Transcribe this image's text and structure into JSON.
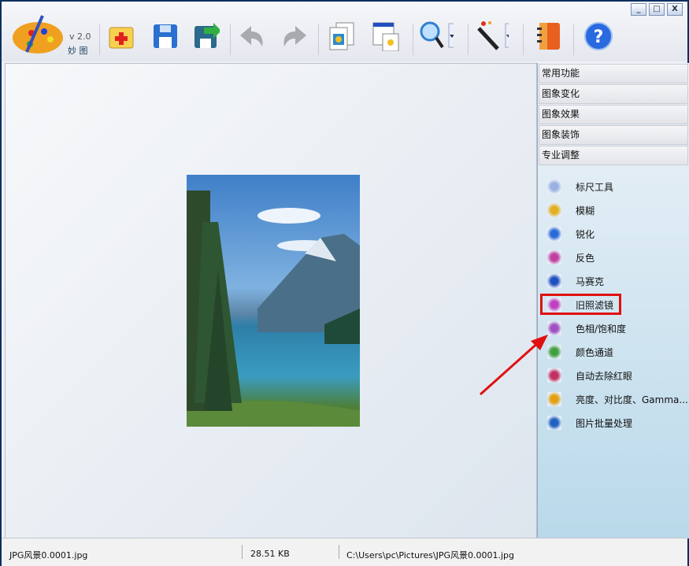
{
  "app": {
    "version": "v 2.0",
    "name": "妙 图"
  },
  "window_buttons": [
    "_",
    "□",
    "X"
  ],
  "toolbar": [
    "open-icon",
    "save-icon",
    "save-as-icon",
    "undo-icon",
    "redo-icon",
    "copy-image-icon",
    "paste-image-icon",
    "zoom-icon",
    "magic-wand-icon",
    "notebook-icon",
    "help-icon"
  ],
  "categories": [
    "常用功能",
    "图象变化",
    "图象效果",
    "图象装饰",
    "专业调整"
  ],
  "tools": [
    {
      "label": "标尺工具",
      "icon": "ruler-icon",
      "color": "#9ab0e0"
    },
    {
      "label": "模糊",
      "icon": "blur-icon",
      "color": "#e0b020"
    },
    {
      "label": "锐化",
      "icon": "sharpen-icon",
      "color": "#2a6ad8"
    },
    {
      "label": "反色",
      "icon": "invert-icon",
      "color": "#c040a0"
    },
    {
      "label": "马赛克",
      "icon": "mosaic-icon",
      "color": "#2050c0"
    },
    {
      "label": "旧照滤镜",
      "icon": "old-photo-filter-icon",
      "color": "#c040c0"
    },
    {
      "label": "色相/饱和度",
      "icon": "hue-saturation-icon",
      "color": "#a050c0"
    },
    {
      "label": "颜色通道",
      "icon": "color-channel-icon",
      "color": "#40a040"
    },
    {
      "label": "自动去除红眼",
      "icon": "red-eye-icon",
      "color": "#c03060"
    },
    {
      "label": "亮度、对比度、Gamma...",
      "icon": "brightness-icon",
      "color": "#e0a010"
    },
    {
      "label": "图片批量处理",
      "icon": "batch-icon",
      "color": "#2060c0"
    }
  ],
  "status": {
    "filename": "JPG风景0.0001.jpg",
    "size": "28.51 KB",
    "path": "C:\\Users\\pc\\Pictures\\JPG风景0.0001.jpg"
  }
}
